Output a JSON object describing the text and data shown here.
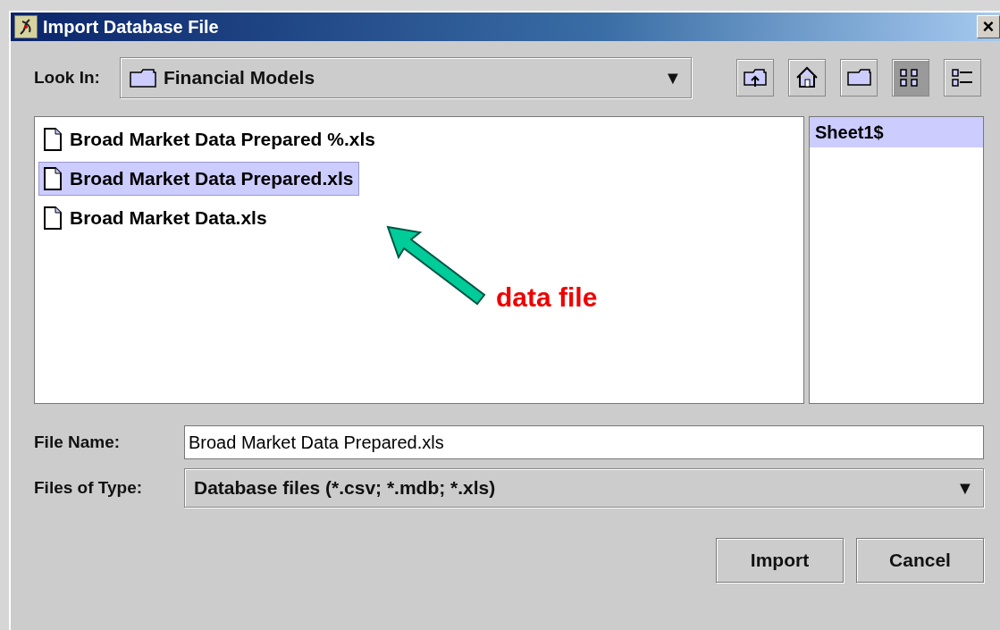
{
  "window": {
    "title": "Import Database File",
    "close": "×"
  },
  "look_in": {
    "label": "Look In:",
    "value": "Financial Models",
    "arrow": "▼"
  },
  "toolbar": [
    {
      "kind": "up",
      "pressed": false
    },
    {
      "kind": "home",
      "pressed": false
    },
    {
      "kind": "new-folder",
      "pressed": false
    },
    {
      "kind": "list",
      "pressed": true
    },
    {
      "kind": "details",
      "pressed": false
    }
  ],
  "files": [
    {
      "name": "Broad Market Data Prepared %.xls",
      "selected": false
    },
    {
      "name": "Broad Market Data Prepared.xls",
      "selected": true
    },
    {
      "name": "Broad Market Data.xls",
      "selected": false
    }
  ],
  "sheets": [
    {
      "name": "Sheet1$",
      "selected": true
    }
  ],
  "annotation": {
    "text": "data file"
  },
  "file_name": {
    "label": "File Name:",
    "value": "Broad Market Data Prepared.xls"
  },
  "file_type": {
    "label": "Files of Type:",
    "value": "Database files (*.csv; *.mdb; *.xls)",
    "arrow": "▼"
  },
  "buttons": [
    "Import",
    "Cancel"
  ]
}
